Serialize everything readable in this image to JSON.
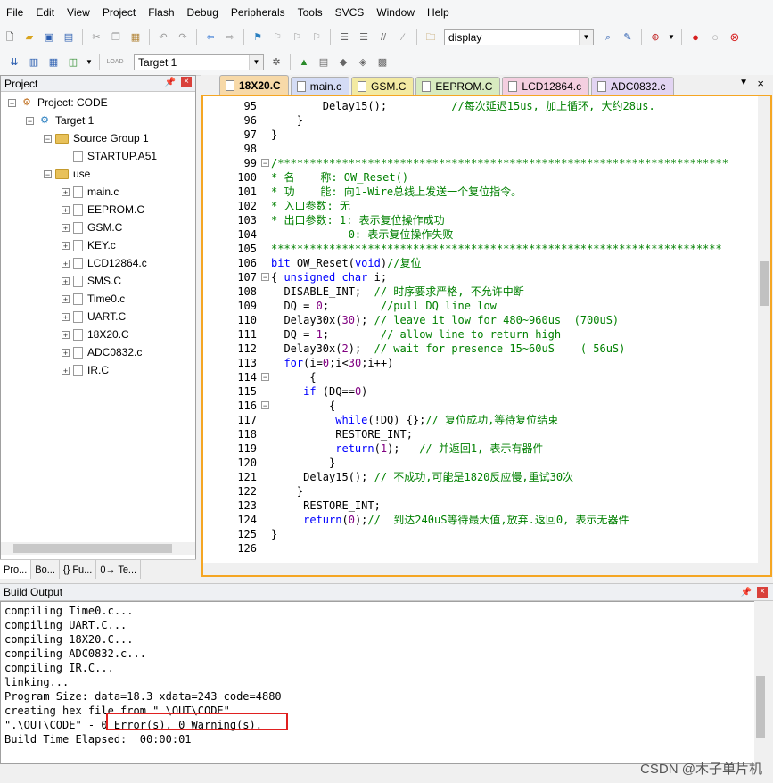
{
  "menu": [
    "File",
    "Edit",
    "View",
    "Project",
    "Flash",
    "Debug",
    "Peripherals",
    "Tools",
    "SVCS",
    "Window",
    "Help"
  ],
  "toolbar": {
    "display_combo": "display",
    "target_combo": "Target 1",
    "load_label": "LOAD"
  },
  "project_panel": {
    "title": "Project",
    "tree": [
      {
        "label": "Project: CODE",
        "level": 0,
        "kind": "project"
      },
      {
        "label": "Target 1",
        "level": 1,
        "kind": "target"
      },
      {
        "label": "Source Group 1",
        "level": 2,
        "kind": "folder"
      },
      {
        "label": "STARTUP.A51",
        "level": 3,
        "kind": "file"
      },
      {
        "label": "use",
        "level": 2,
        "kind": "folder"
      },
      {
        "label": "main.c",
        "level": 3,
        "kind": "file"
      },
      {
        "label": "EEPROM.C",
        "level": 3,
        "kind": "file"
      },
      {
        "label": "GSM.C",
        "level": 3,
        "kind": "file"
      },
      {
        "label": "KEY.c",
        "level": 3,
        "kind": "file"
      },
      {
        "label": "LCD12864.c",
        "level": 3,
        "kind": "file"
      },
      {
        "label": "SMS.C",
        "level": 3,
        "kind": "file"
      },
      {
        "label": "Time0.c",
        "level": 3,
        "kind": "file"
      },
      {
        "label": "UART.C",
        "level": 3,
        "kind": "file"
      },
      {
        "label": "18X20.C",
        "level": 3,
        "kind": "file"
      },
      {
        "label": "ADC0832.c",
        "level": 3,
        "kind": "file"
      },
      {
        "label": "IR.C",
        "level": 3,
        "kind": "file"
      }
    ],
    "tabs": [
      "Pro...",
      "Bo...",
      "{} Fu...",
      "0→ Te..."
    ]
  },
  "editor": {
    "tabs": [
      {
        "label": "18X20.C",
        "color": "#f7d9a8",
        "active": true
      },
      {
        "label": "main.c",
        "color": "#d4dcf5"
      },
      {
        "label": "GSM.C",
        "color": "#f3eaa2"
      },
      {
        "label": "EEPROM.C",
        "color": "#d8ebc0"
      },
      {
        "label": "LCD12864.c",
        "color": "#f4cfe0"
      },
      {
        "label": "ADC0832.c",
        "color": "#e2d4f2"
      }
    ],
    "lines": [
      {
        "n": "95",
        "html": "        Delay15();          <span class='cm'>//每次延迟15us, 加上循环, 大约28us.</span>"
      },
      {
        "n": "96",
        "html": "    }"
      },
      {
        "n": "97",
        "html": "}"
      },
      {
        "n": "98",
        "html": ""
      },
      {
        "n": "99",
        "html": "<span class='cm'>/**********************************************************************</span>",
        "fold": "-"
      },
      {
        "n": "100",
        "html": "<span class='cm'>* 名    称: OW_Reset()</span>"
      },
      {
        "n": "101",
        "html": "<span class='cm'>* 功    能: 向1-Wire总线上发送一个复位指令。</span>"
      },
      {
        "n": "102",
        "html": "<span class='cm'>* 入口参数: 无</span>"
      },
      {
        "n": "103",
        "html": "<span class='cm'>* 出口参数: 1: 表示复位操作成功</span>"
      },
      {
        "n": "104",
        "html": "<span class='cm'>            0: 表示复位操作失败</span>"
      },
      {
        "n": "105",
        "html": "<span class='cm'>**********************************************************************</span>"
      },
      {
        "n": "106",
        "html": "<span class='kw'>bit</span> OW_Reset(<span class='kw'>void</span>)<span class='cm'>//复位</span>"
      },
      {
        "n": "107",
        "html": "{ <span class='kw'>unsigned char</span> i;",
        "fold": "-"
      },
      {
        "n": "108",
        "html": "  DISABLE_INT;  <span class='cm'>// 时序要求严格, 不允许中断</span>"
      },
      {
        "n": "109",
        "html": "  DQ = <span class='num'>0</span>;        <span class='cm'>//pull DQ line low</span>"
      },
      {
        "n": "110",
        "html": "  Delay30x(<span class='num'>30</span>); <span class='cm'>// leave it low for 480~960us  (700uS)</span>"
      },
      {
        "n": "111",
        "html": "  DQ = <span class='num'>1</span>;        <span class='cm'>// allow line to return high</span>"
      },
      {
        "n": "112",
        "html": "  Delay30x(<span class='num'>2</span>);  <span class='cm'>// wait for presence 15~60uS    ( 56uS)</span>"
      },
      {
        "n": "113",
        "html": "  <span class='kw'>for</span>(i=<span class='num'>0</span>;i&lt;<span class='num'>30</span>;i++)"
      },
      {
        "n": "114",
        "html": "      {",
        "fold": "-"
      },
      {
        "n": "115",
        "html": "     <span class='kw'>if</span> (DQ==<span class='num'>0</span>)"
      },
      {
        "n": "116",
        "html": "         {",
        "fold": "-"
      },
      {
        "n": "117",
        "html": "          <span class='kw'>while</span>(!DQ) {};<span class='cm'>// 复位成功,等待复位结束</span>"
      },
      {
        "n": "118",
        "html": "          RESTORE_INT;"
      },
      {
        "n": "119",
        "html": "          <span class='kw'>return</span>(<span class='num'>1</span>);   <span class='cm'>// 并返回1, 表示有器件</span>"
      },
      {
        "n": "120",
        "html": "         }"
      },
      {
        "n": "121",
        "html": "     Delay15(); <span class='cm'>// 不成功,可能是1820反应慢,重试30次</span>"
      },
      {
        "n": "122",
        "html": "    }"
      },
      {
        "n": "123",
        "html": "     RESTORE_INT;"
      },
      {
        "n": "124",
        "html": "     <span class='kw'>return</span>(<span class='num'>0</span>);<span class='cm'>//  到达240uS等待最大值,放弃.返回0, 表示无器件</span>"
      },
      {
        "n": "125",
        "html": "}"
      },
      {
        "n": "126",
        "html": ""
      }
    ]
  },
  "build_output": {
    "title": "Build Output",
    "lines": [
      "compiling Time0.c...",
      "compiling UART.C...",
      "compiling 18X20.C...",
      "compiling ADC0832.c...",
      "compiling IR.C...",
      "linking...",
      "Program Size: data=18.3 xdata=243 code=4880",
      "creating hex file from \".\\OUT\\CODE\"...",
      "\".\\OUT\\CODE\" - 0 Error(s), 0 Warning(s).",
      "Build Time Elapsed:  00:00:01"
    ]
  },
  "watermark": "CSDN @木子单片机",
  "colors": {
    "editor_border": "#f5a623",
    "highlight": "#e02020",
    "keyword": "#0000ff",
    "comment": "#008000"
  }
}
